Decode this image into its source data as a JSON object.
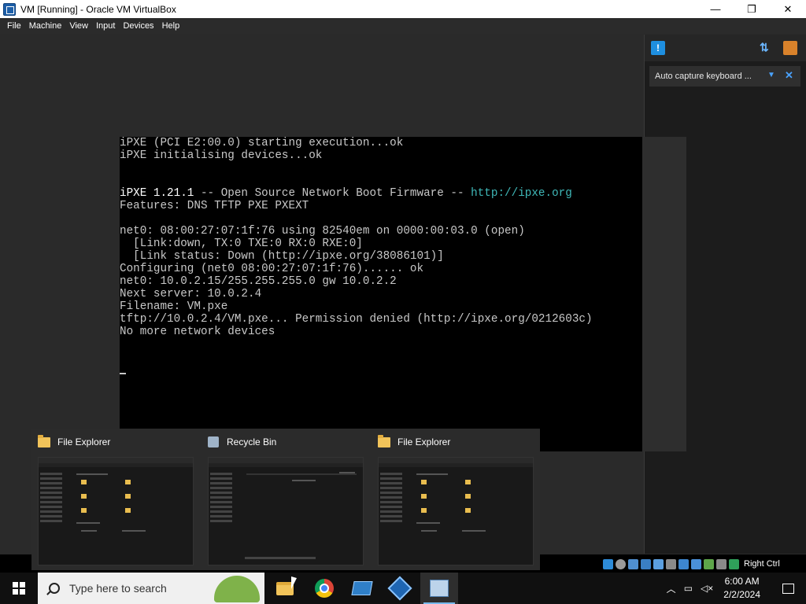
{
  "window": {
    "title": "VM [Running] - Oracle VM VirtualBox",
    "controls": {
      "minimize": "—",
      "maximize": "❐",
      "close": "✕"
    }
  },
  "menu": [
    "File",
    "Machine",
    "View",
    "Input",
    "Devices",
    "Help"
  ],
  "notification": {
    "text": "Auto capture keyboard ...",
    "close": "✕"
  },
  "terminal": {
    "lines": [
      {
        "text": "iPXE (PCI E2:00.0) starting execution...ok"
      },
      {
        "text": "iPXE initialising devices...ok"
      },
      {
        "text": ""
      },
      {
        "text": ""
      },
      {
        "bright": "iPXE 1.21.1",
        "text": " -- Open Source Network Boot Firmware -- ",
        "link": "http://ipxe.org"
      },
      {
        "text": "Features: DNS TFTP PXE PXEXT"
      },
      {
        "text": ""
      },
      {
        "text": "net0: 08:00:27:07:1f:76 using 82540em on 0000:00:03.0 (open)"
      },
      {
        "text": "  [Link:down, TX:0 TXE:0 RX:0 RXE:0]"
      },
      {
        "text": "  [Link status: Down (http://ipxe.org/38086101)]"
      },
      {
        "text": "Configuring (net0 08:00:27:07:1f:76)...... ok"
      },
      {
        "text": "net0: 10.0.2.15/255.255.255.0 gw 10.0.2.2"
      },
      {
        "text": "Next server: 10.0.2.4"
      },
      {
        "text": "Filename: VM.pxe"
      },
      {
        "text": "tftp://10.0.2.4/VM.pxe... Permission denied (http://ipxe.org/0212603c)"
      },
      {
        "text": "No more network devices"
      }
    ]
  },
  "statusbar": {
    "host_key": "Right Ctrl"
  },
  "previews": [
    {
      "title": "File Explorer",
      "icon": "folder-icon"
    },
    {
      "title": "Recycle Bin",
      "icon": "recycle-bin-icon"
    },
    {
      "title": "File Explorer",
      "icon": "folder-icon"
    }
  ],
  "taskbar": {
    "search_placeholder": "Type here to search",
    "apps": [
      "file-explorer",
      "chrome",
      "remote-desktop",
      "virtualbox",
      "vm-window"
    ],
    "clock": {
      "time": "6:00 AM",
      "date": "2/2/2024"
    }
  }
}
